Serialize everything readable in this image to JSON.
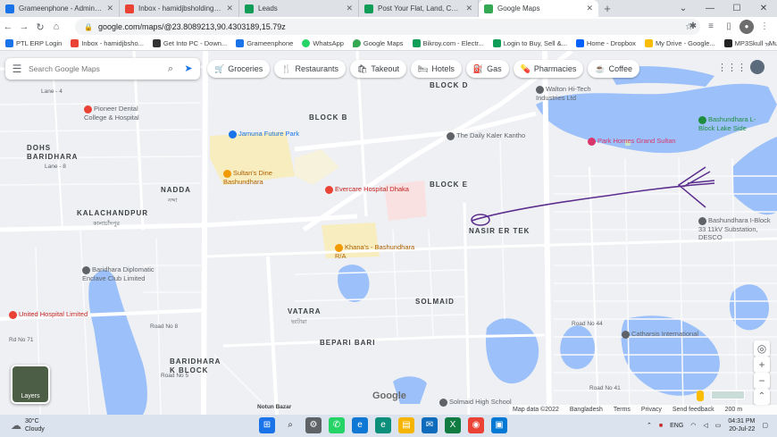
{
  "tabs": [
    {
      "label": "Grameenphone - Administration",
      "color": "#1a73e8",
      "active": false
    },
    {
      "label": "Inbox - hamidjbsholdings@gmail",
      "color": "#ea4335",
      "active": false
    },
    {
      "label": "Leads",
      "color": "#0f9d58",
      "active": false
    },
    {
      "label": "Post Your Flat, Land, Commercial",
      "color": "#0f9d58",
      "active": false
    },
    {
      "label": "Google Maps",
      "color": "#34a853",
      "active": true
    }
  ],
  "address": "google.com/maps/@23.8089213,90.4303189,15.79z",
  "bookmarks": [
    {
      "label": "PTL ERP Login",
      "color": "#1a73e8"
    },
    {
      "label": "Inbox - hamidjbsho...",
      "color": "#ea4335"
    },
    {
      "label": "Get Into PC - Down...",
      "color": "#333333"
    },
    {
      "label": "Grameenphone",
      "color": "#1a73e8"
    },
    {
      "label": "WhatsApp",
      "color": "#25d366"
    },
    {
      "label": "Google Maps",
      "color": "#34a853"
    },
    {
      "label": "Bikroy.com - Electr...",
      "color": "#0f9d58"
    },
    {
      "label": "Login to Buy, Sell &...",
      "color": "#0f9d58"
    },
    {
      "label": "Home - Dropbox",
      "color": "#0061fe"
    },
    {
      "label": "My Drive - Google...",
      "color": "#fbbc04"
    },
    {
      "label": "MP3Skull - Music D...",
      "color": "#222222"
    }
  ],
  "search_placeholder": "Search Google Maps",
  "chips": [
    {
      "label": "Groceries",
      "icon": "cart-icon"
    },
    {
      "label": "Restaurants",
      "icon": "fork-knife-icon"
    },
    {
      "label": "Takeout",
      "icon": "bag-icon"
    },
    {
      "label": "Hotels",
      "icon": "bed-icon"
    },
    {
      "label": "Gas",
      "icon": "fuel-icon"
    },
    {
      "label": "Pharmacies",
      "icon": "pill-icon"
    },
    {
      "label": "Coffee",
      "icon": "cup-icon"
    }
  ],
  "map_labels": {
    "block_d": "BLOCK D",
    "block_b": "BLOCK B",
    "block_e": "BLOCK E",
    "nadda": "NADDA",
    "nadda_bn": "নদ্দা",
    "kalachandpur": "KALACHANDPUR",
    "kalachandpur_bn": "কালাচাঁদপুর",
    "dohs": "DOHS",
    "baridhara": "BARIDHARA",
    "nasir": "NASIR ER TEK",
    "solmaid": "SOLMAID",
    "vatara": "VATARA",
    "vatara_bn": "ভাটারা",
    "bepari": "BEPARI BARI",
    "baridhara_k": "BARIDHARA K BLOCK",
    "lane_4": "Lane - 4",
    "lane_8": "Lane - 8",
    "rd_71": "Rd No 71",
    "road_44": "Road No 44",
    "road_41": "Road No 41",
    "road_8": "Road No 8",
    "road_5": "Road No 5",
    "notun_bazar": "Notun Bazar"
  },
  "pois": [
    {
      "name": "Pioneer Dental College & Hospital",
      "color": "#ea4335"
    },
    {
      "name": "Jamuna Future Park",
      "color": "#1a73e8"
    },
    {
      "name": "Sultan's Dine Bashundhara",
      "color": "#f29900"
    },
    {
      "name": "Evercare Hospital Dhaka",
      "color": "#ea4335"
    },
    {
      "name": "Walton Hi-Tech Industries Ltd",
      "color": "#5f6368"
    },
    {
      "name": "The Daily Kaler Kantho",
      "color": "#5f6368"
    },
    {
      "name": "Park Homes Grand Sultan",
      "color": "#d9366b"
    },
    {
      "name": "Bashundhara L-Block Lake Side",
      "color": "#1e8e3e"
    },
    {
      "name": "Khana's - Bashundhara R/A",
      "color": "#f29900"
    },
    {
      "name": "United Hospital Limited",
      "color": "#ea4335"
    },
    {
      "name": "Baridhara Diplomatic Enclave Club Limited",
      "color": "#5f6368"
    },
    {
      "name": "Catharsis International",
      "color": "#5f6368"
    },
    {
      "name": "Solmaid High School",
      "color": "#5f6368"
    },
    {
      "name": "Bashundhara I-Block 33 11kV Substation, DESCO",
      "color": "#5f6368"
    }
  ],
  "layers_label": "Layers",
  "footer": {
    "map_data": "Map data ©2022",
    "country": "Bangladesh",
    "terms": "Terms",
    "privacy": "Privacy",
    "feedback": "Send feedback",
    "scale": "200 m"
  },
  "google_logo": "Google",
  "weather": {
    "temp": "30°C",
    "condition": "Cloudy"
  },
  "tray": {
    "lang": "ENG",
    "time": "04:31 PM",
    "date": "20-Jul-22"
  }
}
